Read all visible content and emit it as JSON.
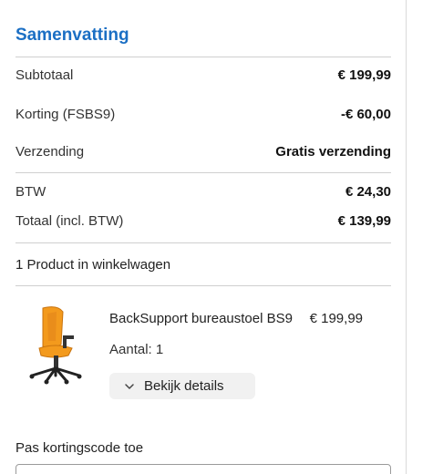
{
  "summary": {
    "title": "Samenvatting",
    "rows": [
      {
        "label": "Subtotaal",
        "value": "€ 199,99"
      },
      {
        "label": "Korting (FSBS9)",
        "value": "-€ 60,00"
      },
      {
        "label": "Verzending",
        "value": "Gratis verzending"
      },
      {
        "label": "BTW",
        "value": "€ 24,30"
      },
      {
        "label": "Totaal (incl. BTW)",
        "value": "€ 139,99"
      }
    ],
    "product_count": "1 Product in winkelwagen"
  },
  "product": {
    "name": "BackSupport bureaustoel BS9",
    "price": "€ 199,99",
    "quantity": "Aantal: 1",
    "details_label": "Bekijk details",
    "image_icon": "office-chair-icon"
  },
  "coupon": {
    "label": "Pas kortingscode toe",
    "value": ""
  },
  "colors": {
    "title": "#1b6fc4",
    "chair_orange": "#f39a1d",
    "divider": "#cfcfcf"
  }
}
